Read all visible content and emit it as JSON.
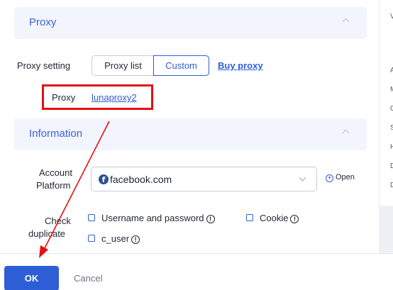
{
  "proxy_section": {
    "title": "Proxy",
    "proxy_setting_label": "Proxy setting",
    "tabs": {
      "proxy_list": "Proxy list",
      "custom": "Custom"
    },
    "buy_proxy": "Buy proxy",
    "proxy_label": "Proxy",
    "proxy_value": "lunaproxy2"
  },
  "information_section": {
    "title": "Information",
    "account_platform_label_1": "Account",
    "account_platform_label_2": "Platform",
    "platform_value": "facebook.com",
    "open_label": "Open",
    "check_duplicate_label_1": "Check",
    "check_duplicate_label_2": "duplicate",
    "options": {
      "username_password": "Username and password",
      "cookie": "Cookie",
      "c_user": "c_user"
    }
  },
  "right_panel": {
    "letters": [
      "V",
      "A",
      "M",
      "C",
      "S",
      "H",
      "D",
      "D"
    ]
  },
  "footer": {
    "ok": "OK",
    "cancel": "Cancel"
  },
  "annotation_color": "#e60f12",
  "accent_color": "#2d5ed6"
}
